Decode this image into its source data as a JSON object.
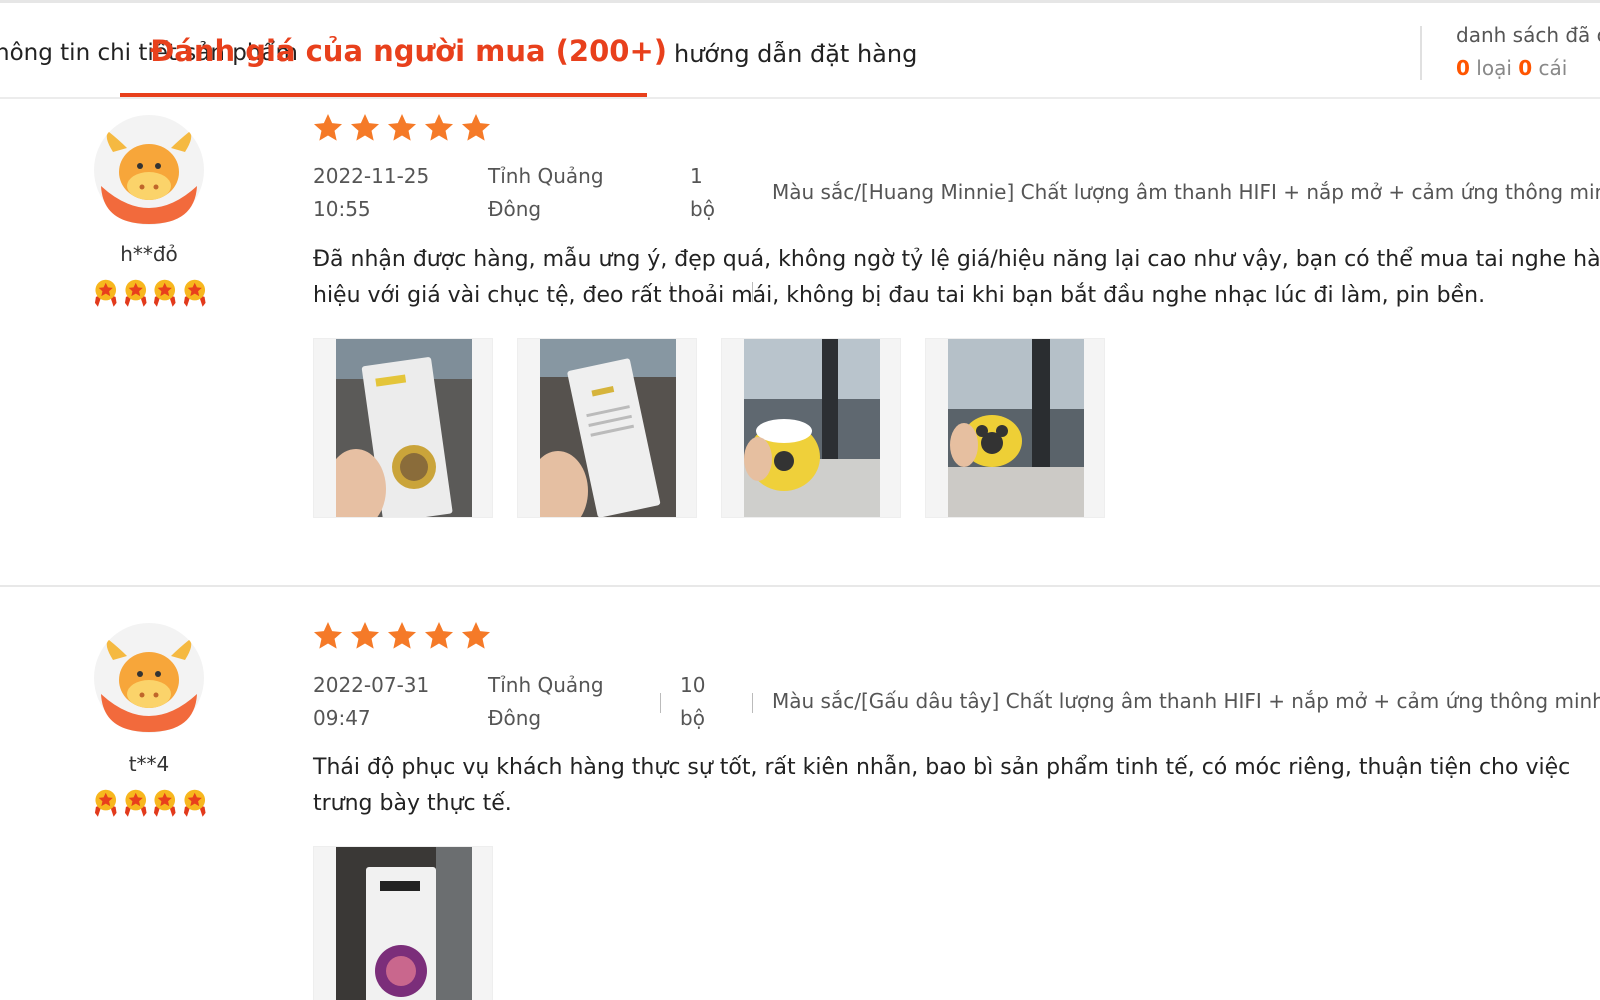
{
  "colors": {
    "accent": "#e8401c",
    "star": "#f57a28",
    "cart_number": "#ff5500"
  },
  "tabs": [
    {
      "label": "thông tin chi tiết sản phẩm"
    },
    {
      "label": "Đánh giá của người mua (200+)",
      "active": true
    },
    {
      "label": "hướng dẫn đặt hàng"
    }
  ],
  "cart": {
    "title": "danh sách đã chọn",
    "types_count": "0",
    "types_label": "loại",
    "items_count": "0",
    "items_label": "cái"
  },
  "reviews": [
    {
      "username": "h**đỏ",
      "rating": 5,
      "medal_count": 4,
      "date": "2022-11-25",
      "time": "10:55",
      "location_line1": "Tỉnh Quảng",
      "location_line2": "Đông",
      "qty_num": "1",
      "qty_unit": "bộ",
      "variant": "Màu sắc/[Huang Minnie] Chất lượng âm thanh HIFI + nắp mở + cảm ứng thông minh",
      "text": "Đã nhận được hàng, mẫu ưng ý, đẹp quá, không ngờ tỷ lệ giá/hiệu năng lại cao như vậy, bạn có thể mua tai nghe hàng hiệu với giá vài chục tệ, đeo rất thoải mái, không bị đau tai khi bạn bắt đầu nghe nhạc lúc đi làm, pin bền.",
      "photos": [
        {
          "icon": "earbuds-box-front-photo"
        },
        {
          "icon": "earbuds-box-back-photo"
        },
        {
          "icon": "open-minnie-case-photo"
        },
        {
          "icon": "minnie-case-photo"
        }
      ]
    },
    {
      "username": "t**4",
      "rating": 5,
      "medal_count": 4,
      "date": "2022-07-31",
      "time": "09:47",
      "location_line1": "Tỉnh Quảng",
      "location_line2": "Đông",
      "qty_num": "10",
      "qty_unit": "bộ",
      "variant": "Màu sắc/[Gấu dâu tây] Chất lượng âm thanh HIFI + nắp mở + cảm ứng thông minh",
      "text": "Thái độ phục vụ khách hàng thực sự tốt, rất kiên nhẫn, bao bì sản phẩm tinh tế, có móc riêng, thuận tiện cho việc trưng bày thực tế.",
      "photos": [
        {
          "icon": "mickey-box-photo"
        }
      ]
    }
  ]
}
